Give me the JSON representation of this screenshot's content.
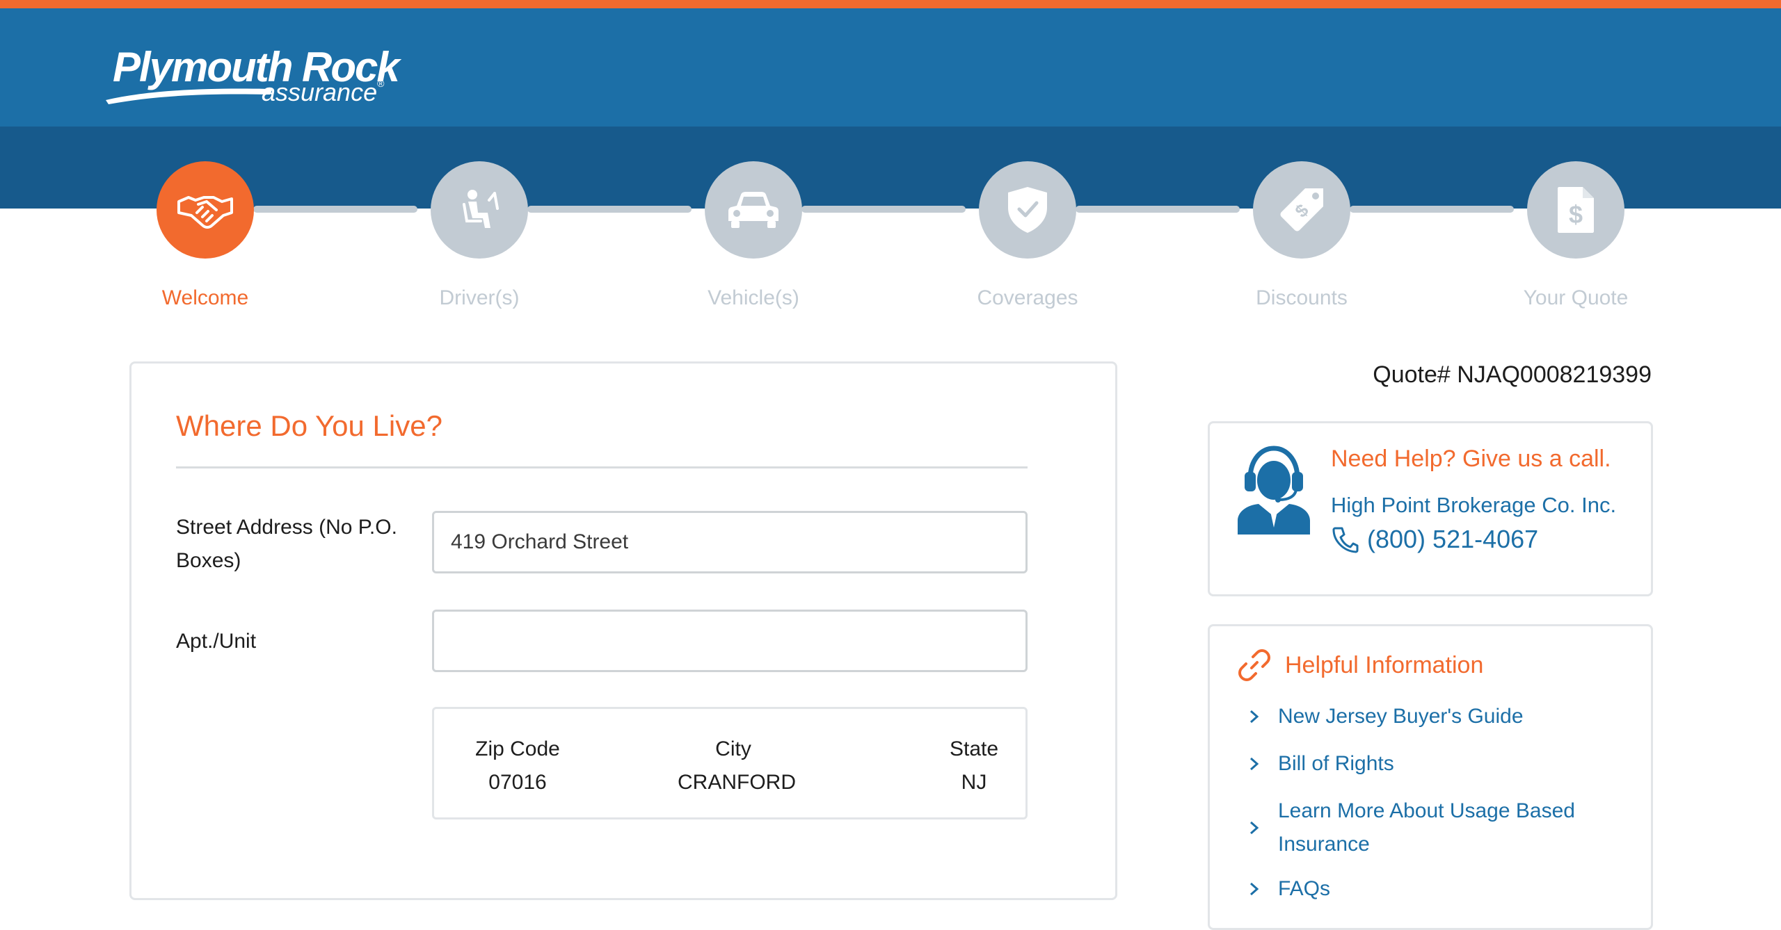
{
  "brand": {
    "name": "Plymouth Rock",
    "sub": "assurance",
    "mark": "®"
  },
  "steps": [
    {
      "label": "Welcome",
      "icon": "handshake-icon",
      "active": true
    },
    {
      "label": "Driver(s)",
      "icon": "driver-seat-icon",
      "active": false
    },
    {
      "label": "Vehicle(s)",
      "icon": "car-icon",
      "active": false
    },
    {
      "label": "Coverages",
      "icon": "shield-check-icon",
      "active": false
    },
    {
      "label": "Discounts",
      "icon": "price-tag-icon",
      "active": false
    },
    {
      "label": "Your Quote",
      "icon": "quote-document-icon",
      "active": false
    }
  ],
  "quote": {
    "number": "Quote# NJAQ0008219399"
  },
  "form": {
    "title": "Where Do You Live?",
    "street_label": "Street Address (No P.O. Boxes)",
    "street_value": "419 Orchard Street",
    "apt_label": "Apt./Unit",
    "apt_value": "",
    "zip_label": "Zip Code",
    "zip_value": "07016",
    "city_label": "City",
    "city_value": "CRANFORD",
    "state_label": "State",
    "state_value": "NJ"
  },
  "help": {
    "title": "Need Help? Give us a call.",
    "broker": "High Point Brokerage Co. Inc.",
    "phone": "(800) 521-4067"
  },
  "info": {
    "title": "Helpful Information",
    "links": [
      "New Jersey Buyer's Guide",
      "Bill of Rights",
      "Learn More About Usage Based Insurance",
      "FAQs"
    ]
  },
  "colors": {
    "accent": "#f26a2e",
    "brand_blue": "#1c6fa7",
    "brand_dark_blue": "#175a8c",
    "inactive_step": "#c2cbd3"
  }
}
